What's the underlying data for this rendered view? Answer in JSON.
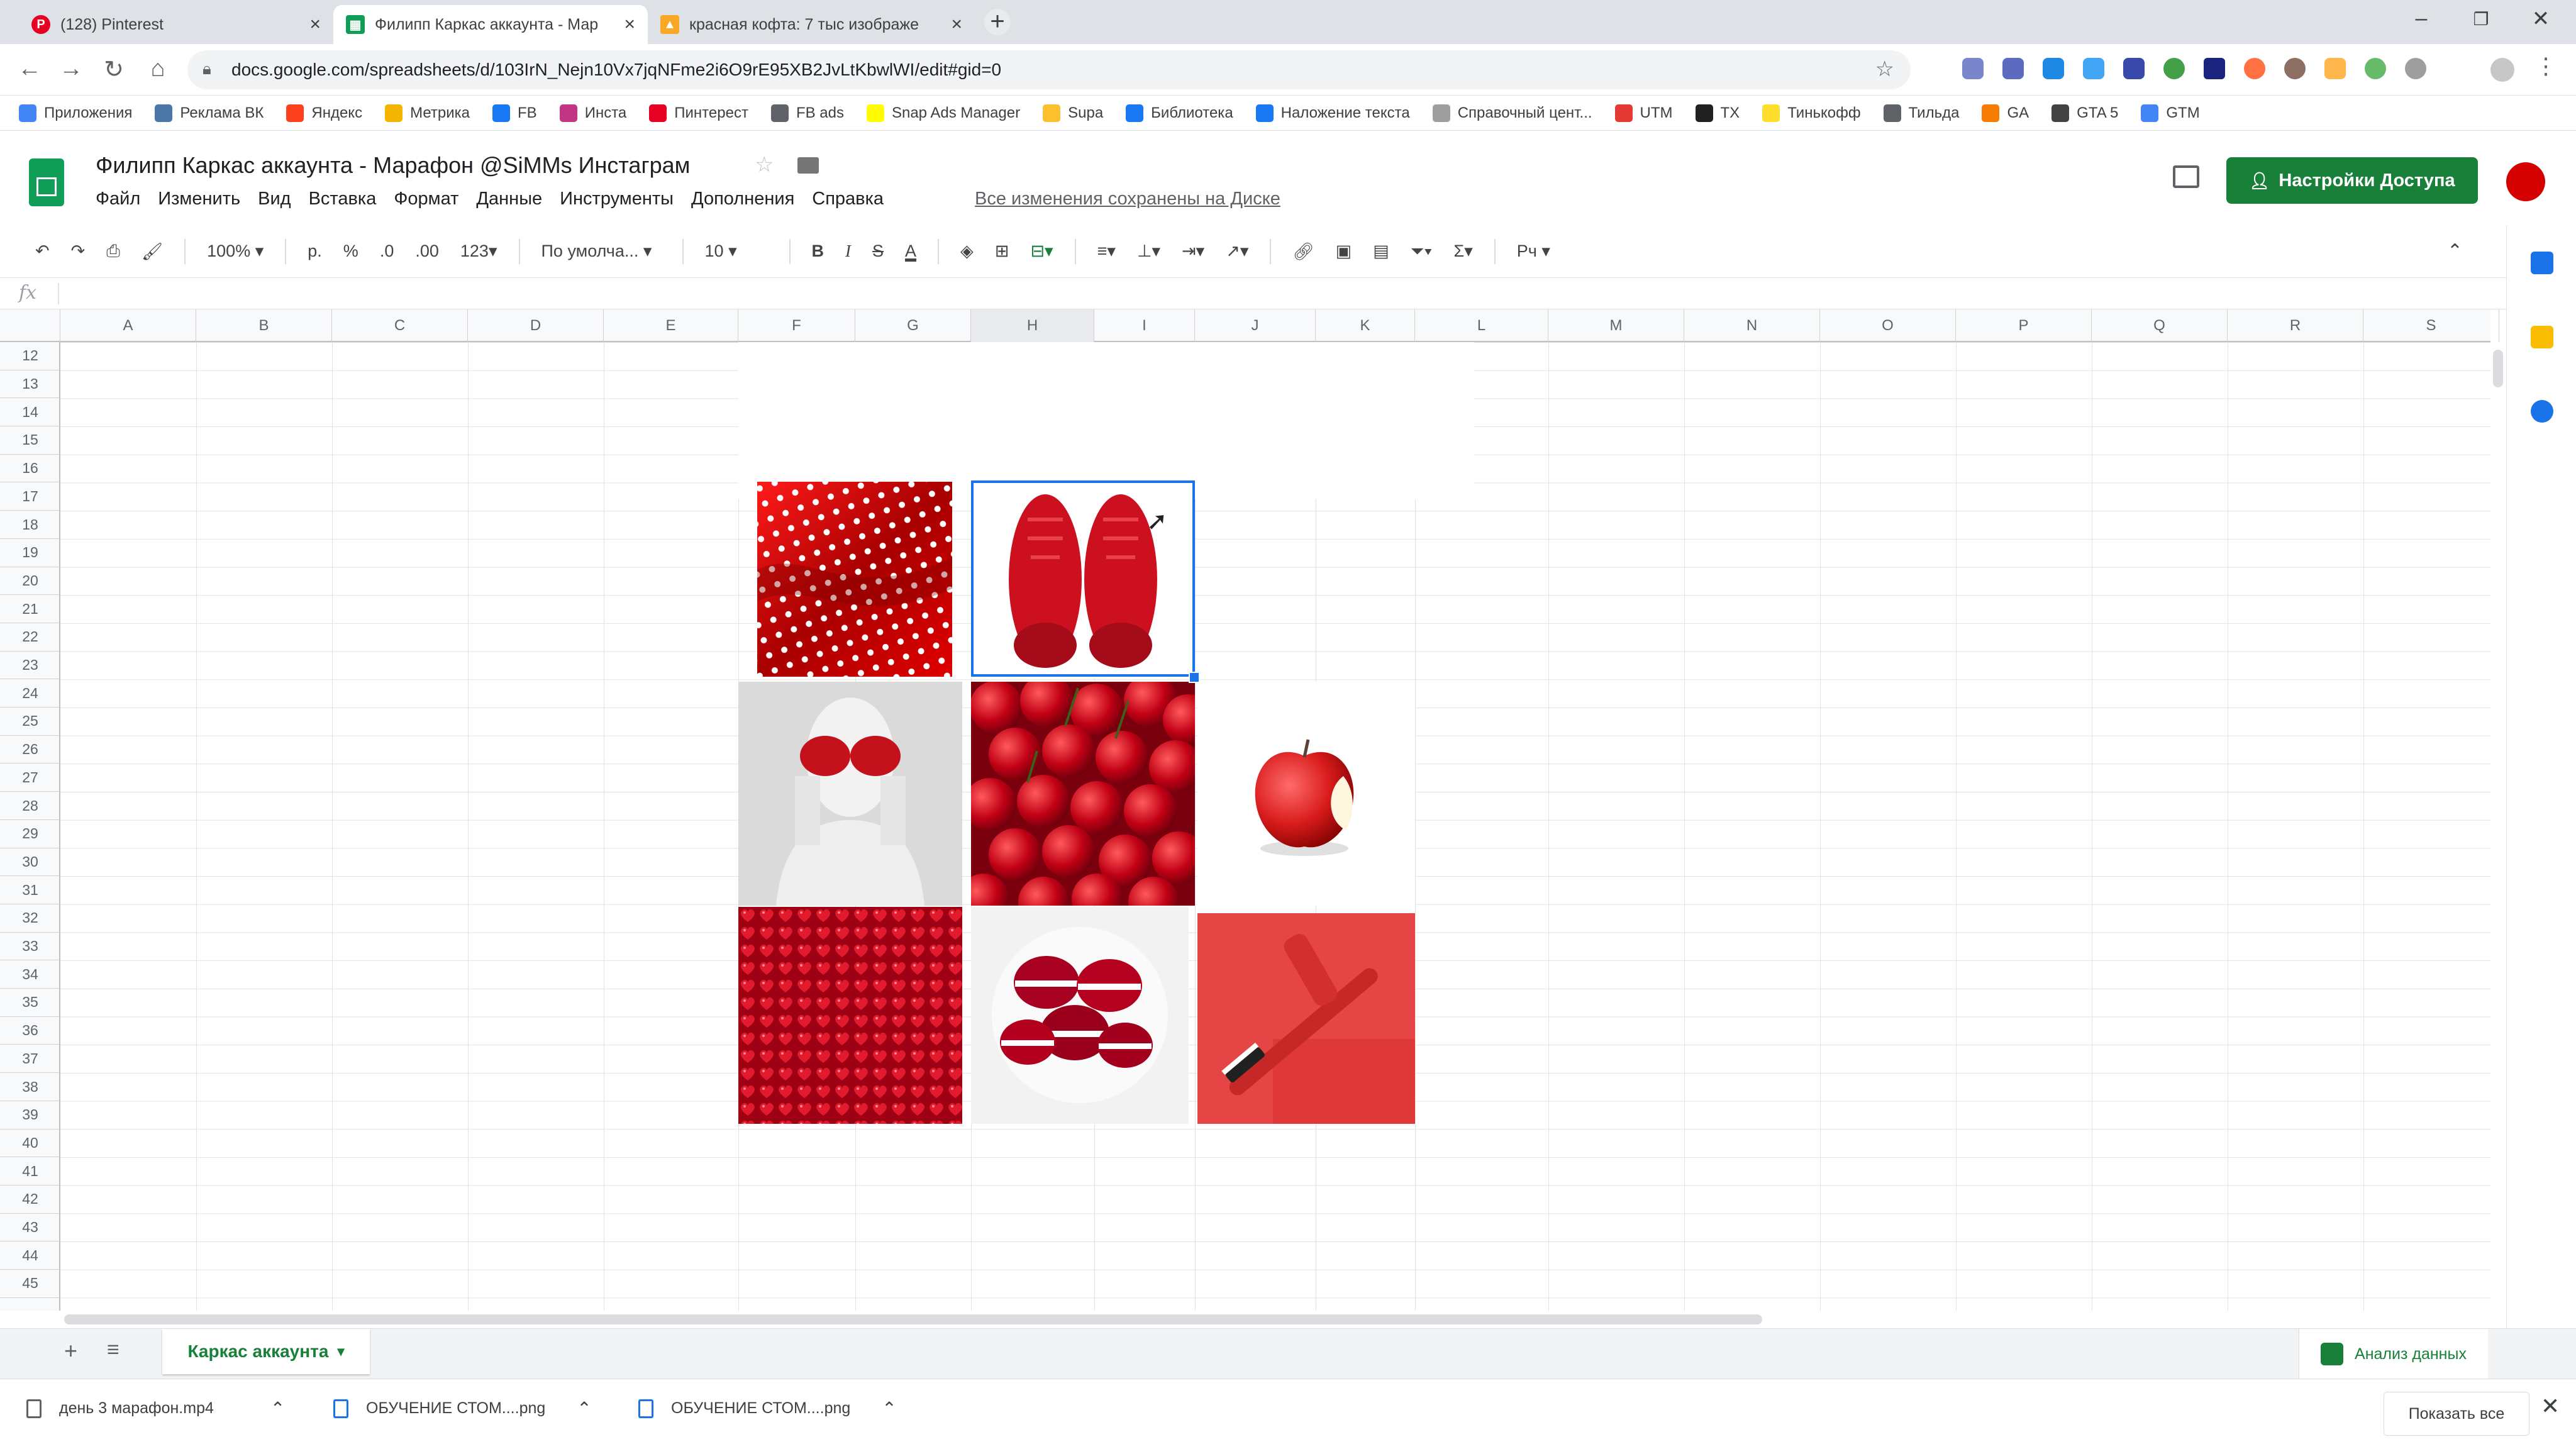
{
  "browser": {
    "tabs": [
      {
        "title": "(128) Pinterest",
        "icon": "pinterest-icon",
        "color": "#e60023"
      },
      {
        "title": "Филипп Каркас аккаунта - Мар",
        "icon": "sheets-icon",
        "color": "#0f9d58"
      },
      {
        "title": "красная кофта: 7 тыс изображе",
        "icon": "yandex-images-icon",
        "color": "#f9a825"
      }
    ],
    "url": "docs.google.com/spreadsheets/d/103IrN_Nejn10Vx7jqNFme2i6O9rE95XB2JvLtKbwlWI/edit#gid=0",
    "bookmarks": [
      {
        "label": "Приложения",
        "color": "#4285f4"
      },
      {
        "label": "Реклама ВК",
        "color": "#4a76a8"
      },
      {
        "label": "Яндекс",
        "color": "#fc3f1d"
      },
      {
        "label": "Метрика",
        "color": "#f4b400"
      },
      {
        "label": "FB",
        "color": "#1877f2"
      },
      {
        "label": "Инста",
        "color": "#c13584"
      },
      {
        "label": "Пинтерест",
        "color": "#e60023"
      },
      {
        "label": "FB ads",
        "color": "#5f6368"
      },
      {
        "label": "Snap Ads Manager",
        "color": "#fffc00"
      },
      {
        "label": "Supa",
        "color": "#fbc02d"
      },
      {
        "label": "Библиотека",
        "color": "#1877f2"
      },
      {
        "label": "Наложение текста",
        "color": "#1877f2"
      },
      {
        "label": "Справочный цент...",
        "color": "#9e9e9e"
      },
      {
        "label": "UTM",
        "color": "#e53935"
      },
      {
        "label": "TX",
        "color": "#212121"
      },
      {
        "label": "Тинькофф",
        "color": "#ffdd2d"
      },
      {
        "label": "Тильда",
        "color": "#5f6368"
      },
      {
        "label": "GA",
        "color": "#f57c00"
      },
      {
        "label": "GTA 5",
        "color": "#424242"
      },
      {
        "label": "GTM",
        "color": "#4285f4"
      }
    ]
  },
  "doc": {
    "title": "Филипп Каркас аккаунта - Марафон @SiMMs Инстаграм",
    "menu": [
      "Файл",
      "Изменить",
      "Вид",
      "Вставка",
      "Формат",
      "Данные",
      "Инструменты",
      "Дополнения",
      "Справка"
    ],
    "saved_status": "Все изменения сохранены на Диске",
    "share_label": "Настройки Доступа"
  },
  "toolbar": {
    "zoom": "100%",
    "currency": "р.",
    "percent": "%",
    "dec_less": ".0",
    "dec_more": ".00",
    "format_more": "123",
    "font": "По умолча...",
    "font_size": "10",
    "bold": "B",
    "italic": "I",
    "strike": "S",
    "text_color": "A",
    "sum": "Σ"
  },
  "formula_bar": {
    "fx": "fx",
    "value": ""
  },
  "columns": [
    "A",
    "B",
    "C",
    "D",
    "E",
    "F",
    "G",
    "H",
    "I",
    "J",
    "K",
    "L",
    "M",
    "N",
    "O",
    "P",
    "Q",
    "R",
    "S"
  ],
  "selected_column": "H",
  "rows": [
    "12",
    "13",
    "14",
    "15",
    "16",
    "17",
    "18",
    "19",
    "20",
    "21",
    "22",
    "23",
    "24",
    "25",
    "26",
    "27",
    "28",
    "29",
    "30",
    "31",
    "32",
    "33",
    "34",
    "35",
    "36",
    "37",
    "38",
    "39",
    "40",
    "41",
    "42",
    "43",
    "44",
    "45"
  ],
  "images": [
    {
      "name": "red-polka-dot-fabric-image",
      "color": "#d50000"
    },
    {
      "name": "red-sneakers-image",
      "color": "#cc1020"
    },
    {
      "name": "woman-red-gloves-image",
      "color": "#cfcfcf"
    },
    {
      "name": "red-cherries-image",
      "color": "#b00015"
    },
    {
      "name": "red-apple-image",
      "color": "#d81b1b"
    },
    {
      "name": "red-hearts-candy-image",
      "color": "#c4001a"
    },
    {
      "name": "red-macarons-image",
      "color": "#a80020"
    },
    {
      "name": "red-toothbrush-image",
      "color": "#e53935"
    }
  ],
  "sheet_tab": "Каркас аккаунта",
  "explore_label": "Анализ данных",
  "downloads": [
    {
      "name": "день 3 марафон.mp4"
    },
    {
      "name": "ОБУЧЕНИЕ СТОМ....png"
    },
    {
      "name": "ОБУЧЕНИЕ СТОМ....png"
    }
  ],
  "show_all_label": "Показать все"
}
